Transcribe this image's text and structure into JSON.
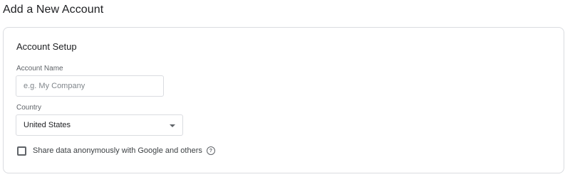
{
  "page": {
    "title": "Add a New Account"
  },
  "card": {
    "title": "Account Setup",
    "account_name": {
      "label": "Account Name",
      "placeholder": "e.g. My Company",
      "value": ""
    },
    "country": {
      "label": "Country",
      "selected": "United States"
    },
    "share_data": {
      "label": "Share data anonymously with Google and others",
      "checked": false,
      "help_icon": "help-circle-icon"
    }
  }
}
